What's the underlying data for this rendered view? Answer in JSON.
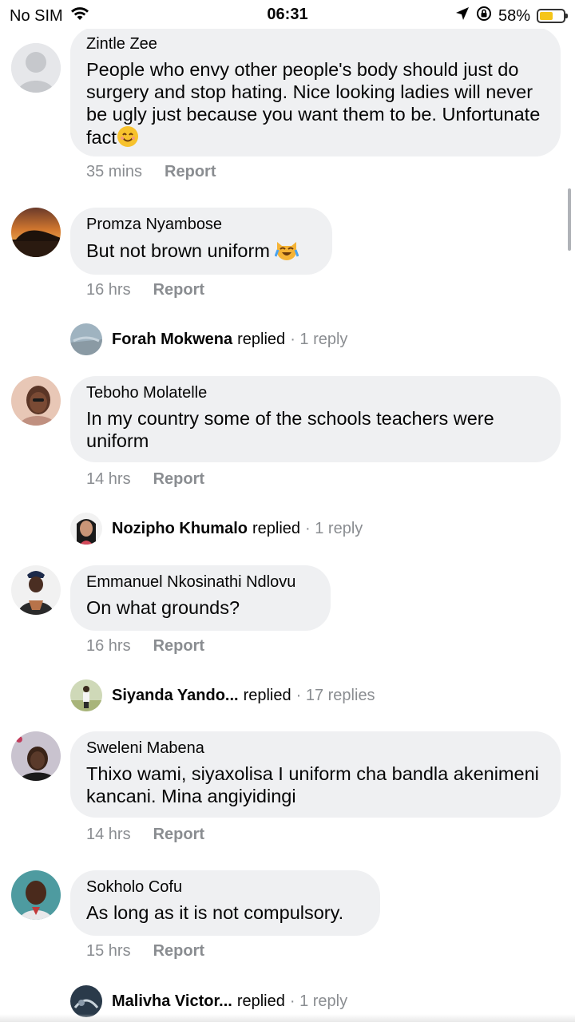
{
  "status_bar": {
    "carrier": "No SIM",
    "time": "06:31",
    "battery_percent": "58%",
    "battery_level": 0.58,
    "icons": [
      "wifi-icon",
      "location-arrow-icon",
      "orientation-lock-icon",
      "battery-icon"
    ]
  },
  "comments": [
    {
      "author": "Zintle Zee",
      "text": "People who envy other people's body should just do surgery and stop hating. Nice looking ladies will never be ugly just because you want them to be. Unfortunate fact",
      "emoji": "smiling-face",
      "time": "35 mins",
      "report": "Report"
    },
    {
      "author": "Promza Nyambose",
      "text": "But not brown uniform ",
      "emoji": "crying-laughing-cat",
      "time": "16 hrs",
      "report": "Report",
      "reply": {
        "name": "Forah Mokwena",
        "verb": "replied",
        "count": "· 1 reply"
      }
    },
    {
      "author": "Teboho Molatelle",
      "text": "In my country some of the schools teachers were uniform",
      "time": "14 hrs",
      "report": "Report",
      "reply": {
        "name": "Nozipho Khumalo",
        "verb": "replied",
        "count": "· 1 reply"
      }
    },
    {
      "author": "Emmanuel Nkosinathi Ndlovu",
      "text": "On what grounds?",
      "time": "16 hrs",
      "report": "Report",
      "reply": {
        "name": "Siyanda Yando...",
        "verb": "replied",
        "count": "· 17 replies"
      }
    },
    {
      "author": "Sweleni Mabena",
      "text": "Thixo wami, siyaxolisa I uniform cha bandla akenimeni kancani. Mina angiyidingi",
      "time": "14 hrs",
      "report": "Report"
    },
    {
      "author": "Sokholo Cofu",
      "text": "As long as it is not compulsory.",
      "time": "15 hrs",
      "report": "Report",
      "reply": {
        "name": "Malivha Victor...",
        "verb": "replied",
        "count": "· 1 reply"
      }
    }
  ]
}
